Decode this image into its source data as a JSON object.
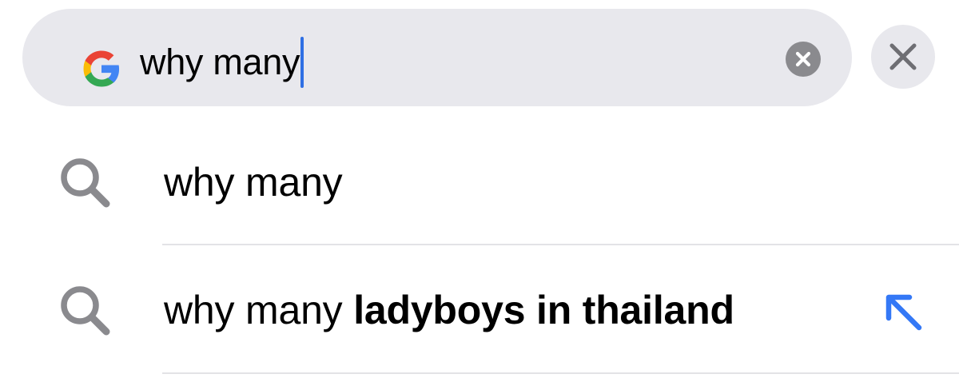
{
  "search": {
    "query": "why many",
    "engine_icon": "google-g-icon",
    "clear_icon": "clear-circle-icon",
    "cancel_icon": "close-icon"
  },
  "suggestions": [
    {
      "icon": "search-icon",
      "text_regular": "why many",
      "text_bold": ""
    },
    {
      "icon": "search-icon",
      "text_regular": "why many",
      "text_bold": "ladyboys in thailand",
      "action_icon": "arrow-up-left-icon"
    }
  ],
  "colors": {
    "search_bg": "#e8e8ed",
    "caret": "#2f6fe4",
    "icon_gray": "#8a8a8e",
    "arrow_blue": "#3478f6",
    "divider": "#e3e3e6"
  }
}
